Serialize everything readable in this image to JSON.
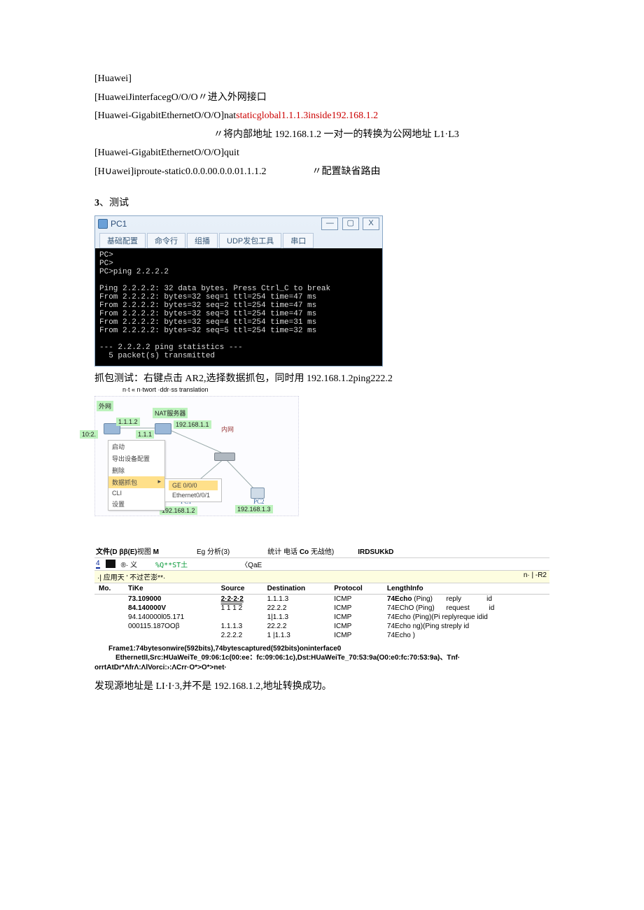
{
  "cfg": {
    "l1": "[Huawei]",
    "l2": "[HuaweiJinterfacegO/O/O〃进入外网接口",
    "l3a": "[Huawei-GigabitEthernetO/O/O]nat",
    "l3b": "staticglobal1.1.1.3inside192.168.1.2",
    "l4": "〃将内部地址 192.168.1.2 一对一的转换为公网地址 L1·L3",
    "l5": "[Huawei-GigabitEthernetO/O/O]quit",
    "l6a": "[H∪awei]iproute-static0.0.0.00.0.0.01.1.1.2",
    "l6b": "〃配置缺省路由"
  },
  "section3": {
    "num": "3",
    "title": "、测试"
  },
  "pc1": {
    "title": "PC1",
    "tabs": [
      "基础配置",
      "命令行",
      "组播",
      "UDP发包工具",
      "串口"
    ],
    "term": "PC>\nPC>\nPC>ping 2.2.2.2\n\nPing 2.2.2.2: 32 data bytes. Press Ctrl_C to break\nFrom 2.2.2.2: bytes=32 seq=1 ttl=254 time=47 ms\nFrom 2.2.2.2: bytes=32 seq=2 ttl=254 time=47 ms\nFrom 2.2.2.2: bytes=32 seq=3 ttl=254 time=47 ms\nFrom 2.2.2.2: bytes=32 seq=4 ttl=254 time=31 ms\nFrom 2.2.2.2: bytes=32 seq=5 ttl=254 time=32 ms\n\n--- 2.2.2.2 ping statistics ---\n  5 packet(s) transmitted",
    "controls": {
      "min": "—",
      "max": "▢",
      "close": "X"
    }
  },
  "capture_caption": "抓包测试：右键点击 AR2,选择数据抓包，同时用 192.168.1.2ping222.2",
  "small_caption": "n·t « n·twort ·ddr·ss translation",
  "topo": {
    "outer": "外网",
    "natserver": "NAT服务器",
    "inner": "内网",
    "ip_1112": "1.1.1.2",
    "ip_102": "10:2.",
    "ip_111": "1.1.1",
    "ip_19216811": "192.168.1.1",
    "ip_19216812": "192.168.1.2",
    "ip_19216813": "192.168.1.3",
    "pc1": "PC1",
    "pc2": "PC2",
    "menu": {
      "m1": "启动",
      "m2": "导出设备配置",
      "m3": "删除",
      "m4": "数据抓包",
      "m5": "CLI",
      "m6": "设置",
      "sub1": "GE 0/0/0",
      "sub2": "Ethernet0/0/1"
    }
  },
  "wireshark": {
    "menu": {
      "a": "文件(D",
      "b": "ββ(E)",
      "c": "视图",
      "d": "M",
      "e": "Eg 分析(3)",
      "f": "统计 电话",
      "g": "Co",
      "h": "无战他)",
      "i": "IRDSUKkD"
    },
    "toolbar": {
      "left": "4",
      "mid": "®· 义",
      "green": "%Q**ST土",
      "qae": "〈QaE"
    },
    "filter": {
      "left": "·| 应用天 ' 不过芒澎**·",
      "right": "n·  |    -R2"
    },
    "headers": {
      "no": "Mo.",
      "time": "TiKe",
      "src": "Source",
      "dst": "Destination",
      "proto": "Protocol",
      "len": "LengthInfo"
    },
    "rows": [
      {
        "t": "73.109000",
        "s": "2·2·2·2",
        "d": "1.1.1.3",
        "p": "ICMP",
        "i": "74Echo (Ping)       reply             id"
      },
      {
        "t": "84.140000V",
        "s": "1 1 1 2",
        "d": "22.2.2",
        "p": "ICMP",
        "i": "74EChO (Ping)      request          id"
      },
      {
        "t": "94.140000l05.171",
        "s": "",
        "d": "1|1.1.3",
        "p": "ICMP",
        "i": "74Echo (Ping)(Pi replyreque idid"
      },
      {
        "t": "000115.187OOβ",
        "s": "1.1.1.3",
        "d": "22.2.2",
        "p": "ICMP",
        "i": "74Echo ng)(Ping streply          id"
      },
      {
        "t": "",
        "s": "2.2.2.2",
        "d": "1 |1.1.3",
        "p": "ICMP",
        "i": "74Echo )"
      }
    ],
    "detail": {
      "l1": "Frame1:74bytesonwire(592bits),74bytescaptured(592bits)oninterface0",
      "l2": "EthernetII,Src:HUaWeiTe_09:06:1c(00:ee：fc:09:06:1c),Dst:HUaWeiTe_70:53:9a(O0:e0:fc:70:53:9a)、Tnf·",
      "l3": "orrtAtDr*ΛfrΛ:ΛlVorci:›:ΛCrr·O*>O*>net·"
    }
  },
  "conclusion": "发现源地址是 LI·I·3,并不是 192.168.1.2,地址转换成功。"
}
